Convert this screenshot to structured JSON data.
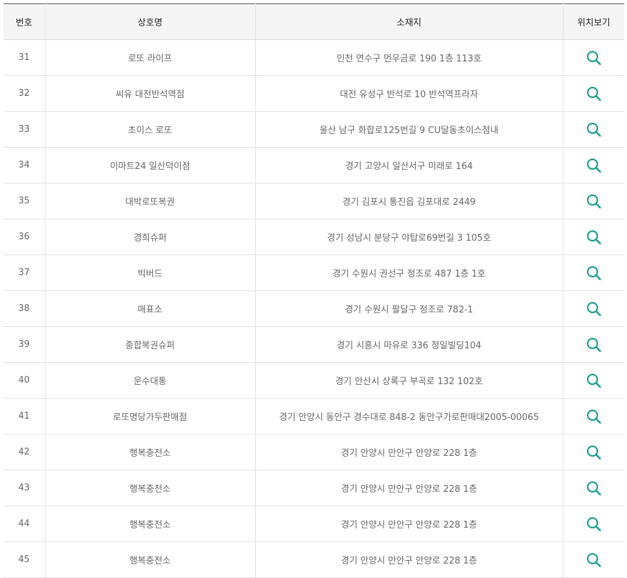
{
  "table": {
    "headers": {
      "number": "번호",
      "name": "상호명",
      "address": "소재지",
      "location": "위치보기"
    },
    "rows": [
      {
        "number": "31",
        "name": "로또 라이프",
        "address": "인천 연수구 먼우금로 190 1층 113호"
      },
      {
        "number": "32",
        "name": "씨유 대전반석역점",
        "address": "대전 유성구 반석로 10 반석역프라자"
      },
      {
        "number": "33",
        "name": "초이스 로또",
        "address": "울산 남구 화합로125번길 9 CU달동초이스점내"
      },
      {
        "number": "34",
        "name": "이마트24 일산덕이점",
        "address": "경기 고양시 일산서구 미래로 164"
      },
      {
        "number": "35",
        "name": "대박로또복권",
        "address": "경기 김포시 통진읍 김포대로 2449"
      },
      {
        "number": "36",
        "name": "경희슈퍼",
        "address": "경기 성남시 분당구 야탑로69번길 3 105호"
      },
      {
        "number": "37",
        "name": "빅버드",
        "address": "경기 수원시 권선구 정조로 487 1층 1호"
      },
      {
        "number": "38",
        "name": "매표소",
        "address": "경기 수원시 팔달구 정조로 782-1"
      },
      {
        "number": "39",
        "name": "종합복권슈퍼",
        "address": "경기 시흥시 마유로 336 정일빌딩104"
      },
      {
        "number": "40",
        "name": "운수대통",
        "address": "경기 안산시 상록구 부곡로 132 102호"
      },
      {
        "number": "41",
        "name": "로또명당가두판매점",
        "address": "경기 안양시 동안구 경수대로 848-2 동안구가로판매대2005-00065"
      },
      {
        "number": "42",
        "name": "행복충전소",
        "address": "경기 안양시 만안구 안양로 228 1층"
      },
      {
        "number": "43",
        "name": "행복충전소",
        "address": "경기 안양시 만안구 안양로 228 1층"
      },
      {
        "number": "44",
        "name": "행복충전소",
        "address": "경기 안양시 만안구 안양로 228 1층"
      },
      {
        "number": "45",
        "name": "행복충전소",
        "address": "경기 안양시 만안구 안양로 228 1층"
      }
    ],
    "location_icon": "search-icon"
  },
  "colors": {
    "accent": "#1a9f90",
    "header_bg": "#f5f5f5",
    "header_top_border": "#555555",
    "row_border": "#e2e2e2",
    "body_text": "#666666",
    "header_text": "#222222"
  }
}
